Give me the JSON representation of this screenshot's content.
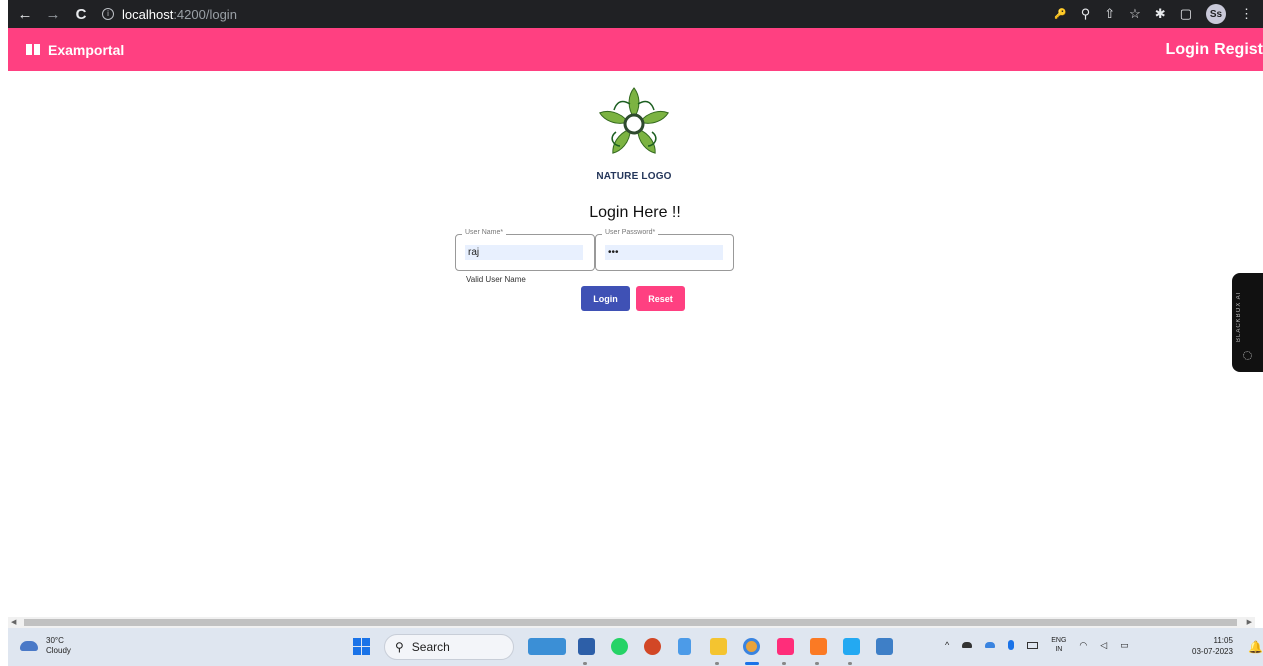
{
  "browser": {
    "back_icon": "←",
    "forward_icon": "→",
    "reload_icon": "C",
    "url_host": "localhost",
    "url_path": ":4200/login",
    "key_icon": "🔑",
    "zoom_icon": "⚲",
    "share_icon": "⇧",
    "star_icon": "☆",
    "ext_icon": "✱",
    "window_icon": "▢",
    "profile_initials": "Ss",
    "menu_icon": "⋮"
  },
  "app": {
    "brand": "Examportal",
    "nav_login": "Login",
    "nav_register": "Regist",
    "accent": "#ff4081",
    "primary": "#3f51b5"
  },
  "logo": {
    "caption": "NATURE LOGO"
  },
  "form": {
    "title": "Login Here !!",
    "username_label": "User Name*",
    "username_value": "raj",
    "password_label": "User Password*",
    "password_value": "•••",
    "username_hint": "Valid User Name",
    "login_label": "Login",
    "reset_label": "Reset"
  },
  "side_widget": {
    "text": "BLACKBOX AI"
  },
  "taskbar": {
    "temperature": "30°C",
    "weather": "Cloudy",
    "search_placeholder": "Search",
    "lang_top": "ENG",
    "lang_bottom": "IN",
    "time": "11:05",
    "date": "03-07-2023",
    "tray_chevron": "^",
    "wifi_icon": "◠",
    "volume_icon": "◁",
    "battery_icon": "▭"
  }
}
